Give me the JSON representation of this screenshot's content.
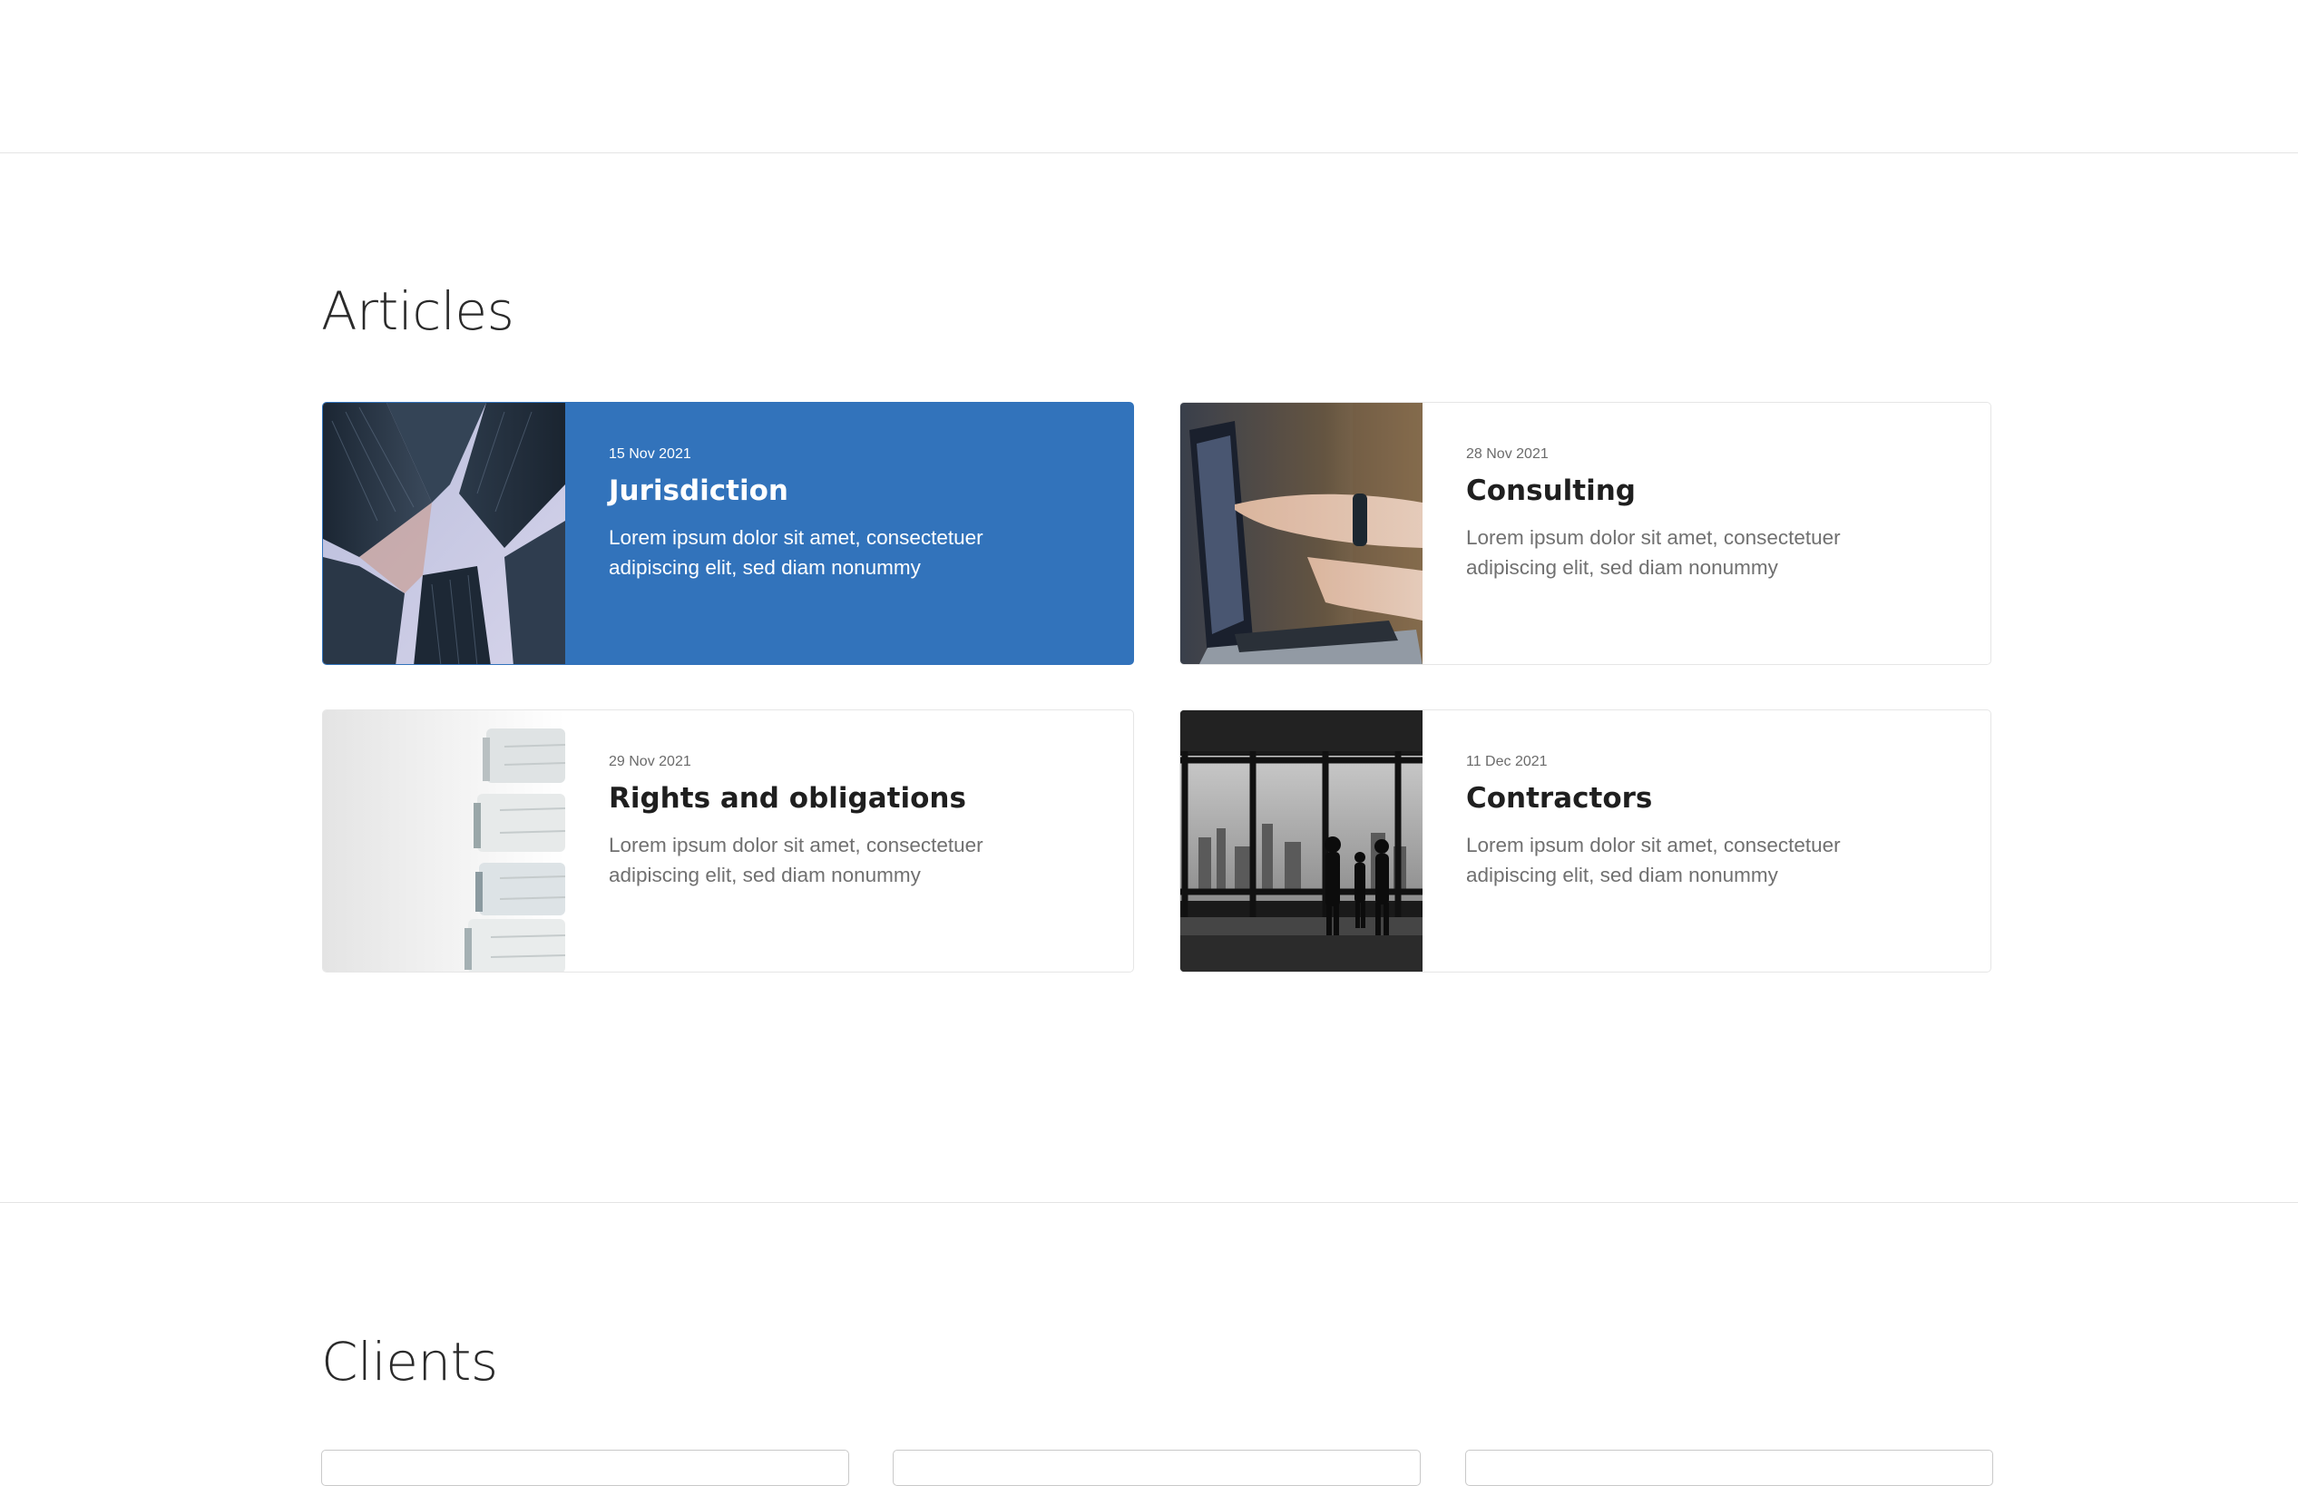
{
  "sections": {
    "articles_title": "Articles",
    "clients_title": "Clients"
  },
  "articles": [
    {
      "date": "15 Nov 2021",
      "title": "Jurisdiction",
      "excerpt": "Lorem ipsum dolor sit amet, consectetuer adipiscing elit, sed diam nonummy",
      "image": "skyscrapers-looking-up",
      "featured": true
    },
    {
      "date": "28 Nov 2021",
      "title": "Consulting",
      "excerpt": "Lorem ipsum dolor sit amet, consectetuer adipiscing elit, sed diam nonummy",
      "image": "hand-pointing-at-laptop",
      "featured": false
    },
    {
      "date": "29 Nov 2021",
      "title": "Rights and obligations",
      "excerpt": "Lorem ipsum dolor sit amet, consectetuer adipiscing elit, sed diam nonummy",
      "image": "stacked-binders",
      "featured": false
    },
    {
      "date": "11 Dec 2021",
      "title": "Contractors",
      "excerpt": "Lorem ipsum dolor sit amet, consectetuer adipiscing elit, sed diam nonummy",
      "image": "people-by-office-window",
      "featured": false
    }
  ],
  "colors": {
    "accent": "#3273bb",
    "title_text": "#1f1f1f",
    "body_text": "#707070",
    "divider": "#e4e4e4"
  }
}
